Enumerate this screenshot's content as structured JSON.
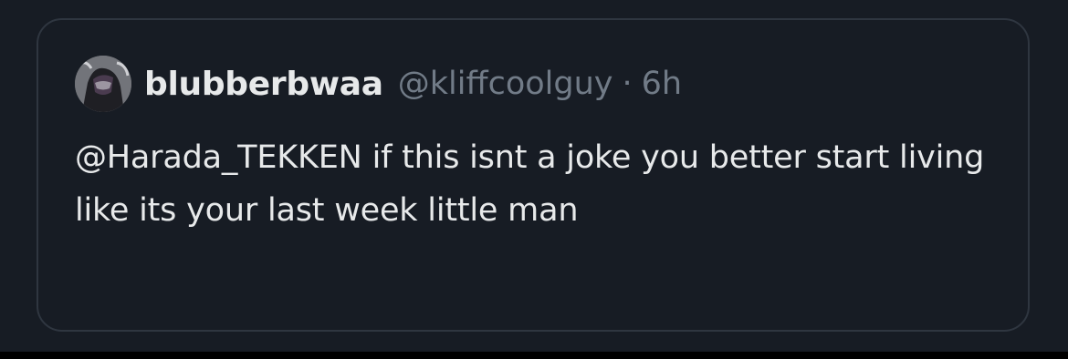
{
  "tweet": {
    "display_name": "blubberbwaa",
    "handle": "@kliffcoolguy",
    "separator": "·",
    "time": "6h",
    "text": "@Harada_TEKKEN if this isnt a joke you better start living like its your last week little man"
  },
  "colors": {
    "background": "#171c24",
    "border": "#2f3640",
    "primary_text": "#e7e9ea",
    "secondary_text": "#717b87"
  },
  "icons": {
    "avatar": "user-avatar-image"
  }
}
